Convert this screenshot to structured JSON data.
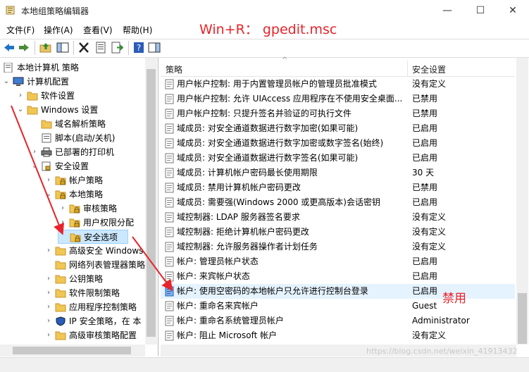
{
  "window": {
    "title": "本地组策略编辑器",
    "min_glyph": "—",
    "max_glyph": "☐",
    "close_glyph": "✕"
  },
  "menu": [
    "文件(F)",
    "操作(A)",
    "查看(V)",
    "帮助(H)"
  ],
  "annotations": {
    "command": "Win+R： gpedit.msc",
    "disabled_note": "禁用",
    "watermark": "https://blog.csdn.net/weixin_41913432"
  },
  "tree": {
    "root": "本地计算机 策略",
    "items": [
      {
        "label": "计算机配置",
        "twist": "⌄",
        "icon": "computer"
      },
      {
        "label": "软件设置",
        "twist": "›",
        "icon": "folder"
      },
      {
        "label": "Windows 设置",
        "twist": "⌄",
        "icon": "folder"
      },
      {
        "label": "域名解析策略",
        "twist": "",
        "icon": "folder"
      },
      {
        "label": "脚本(启动/关机)",
        "twist": "",
        "icon": "script"
      },
      {
        "label": "已部署的打印机",
        "twist": "›",
        "icon": "printer"
      },
      {
        "label": "安全设置",
        "twist": "⌄",
        "icon": "security"
      },
      {
        "label": "帐户策略",
        "twist": "›",
        "icon": "folder-lock"
      },
      {
        "label": "本地策略",
        "twist": "⌄",
        "icon": "folder-lock"
      },
      {
        "label": "审核策略",
        "twist": "›",
        "icon": "folder-lock"
      },
      {
        "label": "用户权限分配",
        "twist": "›",
        "icon": "folder-lock"
      },
      {
        "label": "安全选项",
        "twist": "",
        "icon": "folder-lock",
        "selected": true
      },
      {
        "label": "高级安全 Windows",
        "twist": "›",
        "icon": "folder"
      },
      {
        "label": "网络列表管理器策略",
        "twist": "",
        "icon": "folder"
      },
      {
        "label": "公钥策略",
        "twist": "›",
        "icon": "folder"
      },
      {
        "label": "软件限制策略",
        "twist": "›",
        "icon": "folder"
      },
      {
        "label": "应用程序控制策略",
        "twist": "›",
        "icon": "folder"
      },
      {
        "label": "IP 安全策略，在 本",
        "twist": "›",
        "icon": "shield"
      },
      {
        "label": "高级审核策略配置",
        "twist": "›",
        "icon": "folder"
      }
    ]
  },
  "list": {
    "columns": [
      "策略",
      "安全设置"
    ],
    "sort_glyph": "^",
    "rows": [
      {
        "policy": "用户帐户控制: 用于内置管理员帐户的管理员批准模式",
        "setting": "没有定义"
      },
      {
        "policy": "用户帐户控制: 允许 UIAccess 应用程序在不使用安全桌面...",
        "setting": "已禁用"
      },
      {
        "policy": "用户帐户控制: 只提升签名并验证的可执行文件",
        "setting": "已禁用"
      },
      {
        "policy": "域成员: 对安全通道数据进行数字加密(如果可能)",
        "setting": "已启用"
      },
      {
        "policy": "域成员: 对安全通道数据进行数字加密或数字签名(始终)",
        "setting": "已启用"
      },
      {
        "policy": "域成员: 对安全通道数据进行数字签名(如果可能)",
        "setting": "已启用"
      },
      {
        "policy": "域成员: 计算机帐户密码最长使用期限",
        "setting": "30 天"
      },
      {
        "policy": "域成员: 禁用计算机帐户密码更改",
        "setting": "已禁用"
      },
      {
        "policy": "域成员: 需要强(Windows 2000 或更高版本)会话密钥",
        "setting": "已启用"
      },
      {
        "policy": "域控制器: LDAP 服务器签名要求",
        "setting": "没有定义"
      },
      {
        "policy": "域控制器: 拒绝计算机帐户密码更改",
        "setting": "没有定义"
      },
      {
        "policy": "域控制器: 允许服务器操作者计划任务",
        "setting": "没有定义"
      },
      {
        "policy": "帐户: 管理员帐户状态",
        "setting": "已启用"
      },
      {
        "policy": "帐户: 来宾帐户状态",
        "setting": "已启用"
      },
      {
        "policy": "帐户: 使用空密码的本地帐户只允许进行控制台登录",
        "setting": "已启用",
        "highlight": true
      },
      {
        "policy": "帐户: 重命名来宾帐户",
        "setting": "Guest"
      },
      {
        "policy": "帐户: 重命名系统管理员帐户",
        "setting": "Administrator"
      },
      {
        "policy": "帐户: 阻止 Microsoft 帐户",
        "setting": "没有定义"
      }
    ]
  },
  "colors": {
    "annotation_red": "#e8242a",
    "selection": "#cce8ff",
    "row_highlight": "#e5f3ff"
  }
}
